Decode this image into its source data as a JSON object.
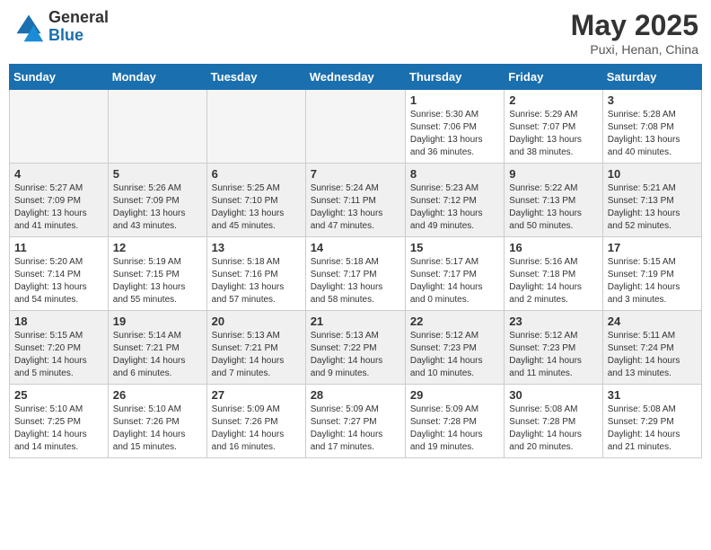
{
  "header": {
    "logo_general": "General",
    "logo_blue": "Blue",
    "month_year": "May 2025",
    "location": "Puxi, Henan, China"
  },
  "weekdays": [
    "Sunday",
    "Monday",
    "Tuesday",
    "Wednesday",
    "Thursday",
    "Friday",
    "Saturday"
  ],
  "weeks": [
    [
      {
        "day": "",
        "info": ""
      },
      {
        "day": "",
        "info": ""
      },
      {
        "day": "",
        "info": ""
      },
      {
        "day": "",
        "info": ""
      },
      {
        "day": "1",
        "info": "Sunrise: 5:30 AM\nSunset: 7:06 PM\nDaylight: 13 hours\nand 36 minutes."
      },
      {
        "day": "2",
        "info": "Sunrise: 5:29 AM\nSunset: 7:07 PM\nDaylight: 13 hours\nand 38 minutes."
      },
      {
        "day": "3",
        "info": "Sunrise: 5:28 AM\nSunset: 7:08 PM\nDaylight: 13 hours\nand 40 minutes."
      }
    ],
    [
      {
        "day": "4",
        "info": "Sunrise: 5:27 AM\nSunset: 7:09 PM\nDaylight: 13 hours\nand 41 minutes."
      },
      {
        "day": "5",
        "info": "Sunrise: 5:26 AM\nSunset: 7:09 PM\nDaylight: 13 hours\nand 43 minutes."
      },
      {
        "day": "6",
        "info": "Sunrise: 5:25 AM\nSunset: 7:10 PM\nDaylight: 13 hours\nand 45 minutes."
      },
      {
        "day": "7",
        "info": "Sunrise: 5:24 AM\nSunset: 7:11 PM\nDaylight: 13 hours\nand 47 minutes."
      },
      {
        "day": "8",
        "info": "Sunrise: 5:23 AM\nSunset: 7:12 PM\nDaylight: 13 hours\nand 49 minutes."
      },
      {
        "day": "9",
        "info": "Sunrise: 5:22 AM\nSunset: 7:13 PM\nDaylight: 13 hours\nand 50 minutes."
      },
      {
        "day": "10",
        "info": "Sunrise: 5:21 AM\nSunset: 7:13 PM\nDaylight: 13 hours\nand 52 minutes."
      }
    ],
    [
      {
        "day": "11",
        "info": "Sunrise: 5:20 AM\nSunset: 7:14 PM\nDaylight: 13 hours\nand 54 minutes."
      },
      {
        "day": "12",
        "info": "Sunrise: 5:19 AM\nSunset: 7:15 PM\nDaylight: 13 hours\nand 55 minutes."
      },
      {
        "day": "13",
        "info": "Sunrise: 5:18 AM\nSunset: 7:16 PM\nDaylight: 13 hours\nand 57 minutes."
      },
      {
        "day": "14",
        "info": "Sunrise: 5:18 AM\nSunset: 7:17 PM\nDaylight: 13 hours\nand 58 minutes."
      },
      {
        "day": "15",
        "info": "Sunrise: 5:17 AM\nSunset: 7:17 PM\nDaylight: 14 hours\nand 0 minutes."
      },
      {
        "day": "16",
        "info": "Sunrise: 5:16 AM\nSunset: 7:18 PM\nDaylight: 14 hours\nand 2 minutes."
      },
      {
        "day": "17",
        "info": "Sunrise: 5:15 AM\nSunset: 7:19 PM\nDaylight: 14 hours\nand 3 minutes."
      }
    ],
    [
      {
        "day": "18",
        "info": "Sunrise: 5:15 AM\nSunset: 7:20 PM\nDaylight: 14 hours\nand 5 minutes."
      },
      {
        "day": "19",
        "info": "Sunrise: 5:14 AM\nSunset: 7:21 PM\nDaylight: 14 hours\nand 6 minutes."
      },
      {
        "day": "20",
        "info": "Sunrise: 5:13 AM\nSunset: 7:21 PM\nDaylight: 14 hours\nand 7 minutes."
      },
      {
        "day": "21",
        "info": "Sunrise: 5:13 AM\nSunset: 7:22 PM\nDaylight: 14 hours\nand 9 minutes."
      },
      {
        "day": "22",
        "info": "Sunrise: 5:12 AM\nSunset: 7:23 PM\nDaylight: 14 hours\nand 10 minutes."
      },
      {
        "day": "23",
        "info": "Sunrise: 5:12 AM\nSunset: 7:23 PM\nDaylight: 14 hours\nand 11 minutes."
      },
      {
        "day": "24",
        "info": "Sunrise: 5:11 AM\nSunset: 7:24 PM\nDaylight: 14 hours\nand 13 minutes."
      }
    ],
    [
      {
        "day": "25",
        "info": "Sunrise: 5:10 AM\nSunset: 7:25 PM\nDaylight: 14 hours\nand 14 minutes."
      },
      {
        "day": "26",
        "info": "Sunrise: 5:10 AM\nSunset: 7:26 PM\nDaylight: 14 hours\nand 15 minutes."
      },
      {
        "day": "27",
        "info": "Sunrise: 5:09 AM\nSunset: 7:26 PM\nDaylight: 14 hours\nand 16 minutes."
      },
      {
        "day": "28",
        "info": "Sunrise: 5:09 AM\nSunset: 7:27 PM\nDaylight: 14 hours\nand 17 minutes."
      },
      {
        "day": "29",
        "info": "Sunrise: 5:09 AM\nSunset: 7:28 PM\nDaylight: 14 hours\nand 19 minutes."
      },
      {
        "day": "30",
        "info": "Sunrise: 5:08 AM\nSunset: 7:28 PM\nDaylight: 14 hours\nand 20 minutes."
      },
      {
        "day": "31",
        "info": "Sunrise: 5:08 AM\nSunset: 7:29 PM\nDaylight: 14 hours\nand 21 minutes."
      }
    ]
  ]
}
